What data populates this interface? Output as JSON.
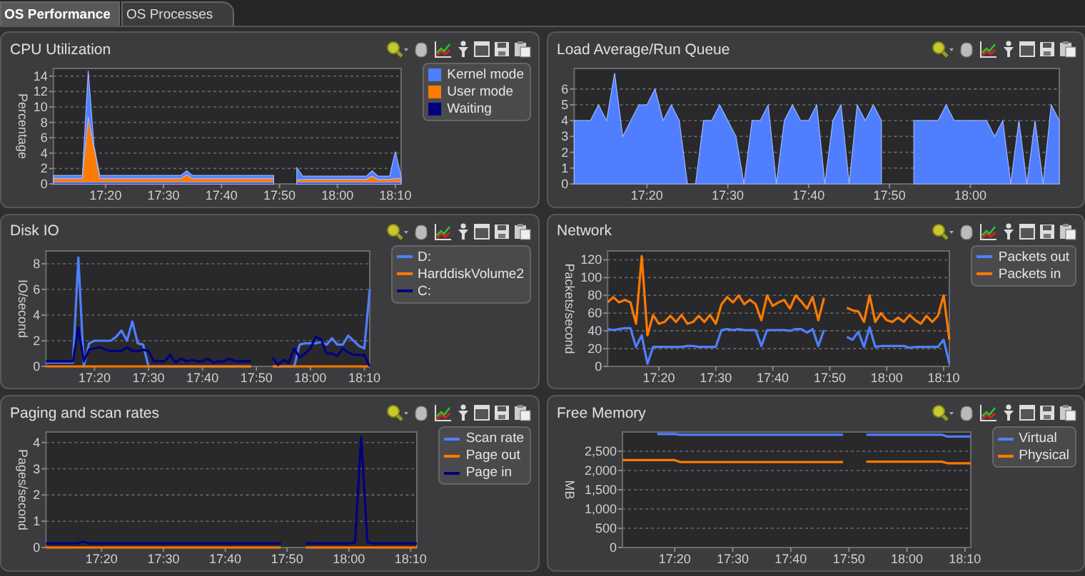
{
  "tabs": [
    {
      "label": "OS Performance",
      "selected": true
    },
    {
      "label": "OS Processes",
      "selected": false
    }
  ],
  "panels": [
    {
      "title": "CPU Utilization",
      "chart_data": {
        "type": "area",
        "ylabel": "Percentage",
        "categories": [
          null,
          null,
          null,
          null,
          null,
          null,
          null,
          null,
          null,
          "17:20",
          null,
          null,
          null,
          null,
          null,
          null,
          null,
          null,
          null,
          "17:30",
          null,
          null,
          null,
          null,
          null,
          null,
          null,
          null,
          null,
          "17:40",
          null,
          null,
          null,
          null,
          null,
          null,
          null,
          null,
          null,
          "17:50",
          null,
          null,
          null,
          null,
          null,
          null,
          null,
          null,
          null,
          "18:00",
          null,
          null,
          null,
          null,
          null,
          null,
          null,
          null,
          null,
          "18:10",
          null
        ],
        "ylim": [
          0,
          15
        ],
        "yticks": [
          0,
          2,
          4,
          6,
          8,
          10,
          12,
          14
        ],
        "series": [
          {
            "name": "Kernel mode",
            "color": "#4f7fff",
            "values": [
              1.1,
              1.1,
              1.1,
              1.1,
              1.1,
              1.1,
              14.7,
              5,
              1.1,
              1.1,
              1.1,
              1.1,
              1.1,
              1.1,
              1.1,
              1.1,
              1.1,
              1.1,
              1.1,
              1.1,
              1.1,
              1.1,
              1.1,
              1.7,
              1.1,
              1.1,
              1.1,
              1.1,
              1.1,
              1.1,
              1.1,
              1.1,
              1.1,
              1.1,
              1.1,
              1.1,
              1.1,
              1.1,
              1.1,
              null,
              null,
              null,
              2.1,
              1.0,
              1.0,
              1.0,
              1.0,
              1.0,
              1.0,
              1.0,
              1.0,
              1.0,
              1.0,
              1.0,
              1.0,
              1.7,
              1.0,
              1.0,
              1.0,
              4.2,
              1.0
            ]
          },
          {
            "name": "User mode",
            "color": "#ff7a00",
            "values": [
              0.7,
              0.7,
              0.7,
              0.7,
              0.7,
              0.7,
              8.7,
              4.7,
              0.7,
              0.7,
              0.7,
              0.7,
              0.7,
              0.7,
              0.7,
              0.7,
              0.7,
              0.7,
              0.7,
              0.7,
              0.7,
              0.7,
              0.7,
              1.2,
              0.7,
              0.7,
              0.7,
              0.7,
              0.7,
              0.7,
              0.7,
              0.7,
              0.7,
              0.7,
              0.7,
              0.7,
              0.7,
              0.7,
              0.7,
              null,
              null,
              null,
              0.5,
              0.6,
              0.6,
              0.6,
              0.6,
              0.6,
              0.6,
              0.6,
              0.6,
              0.6,
              0.6,
              0.6,
              0.6,
              1.0,
              0.6,
              0.6,
              0.6,
              0.7,
              0.7
            ]
          },
          {
            "name": "Waiting",
            "color": "#00007f",
            "values": [
              0.2,
              0.2,
              0.2,
              0.2,
              0.2,
              0.2,
              0.2,
              0.2,
              0.2,
              0.2,
              0.2,
              0.2,
              0.2,
              0.2,
              0.2,
              0.2,
              0.2,
              0.2,
              0.2,
              0.2,
              0.2,
              0.2,
              0.2,
              0.2,
              0.2,
              0.2,
              0.2,
              0.2,
              0.2,
              0.2,
              0.2,
              0.2,
              0.2,
              0.2,
              0.2,
              0.2,
              0.2,
              0.2,
              0.2,
              null,
              null,
              null,
              0.2,
              0.2,
              0.2,
              0.2,
              0.2,
              0.2,
              0.2,
              0.2,
              0.2,
              0.2,
              0.2,
              0.2,
              0.2,
              0.2,
              0.2,
              0.2,
              0.2,
              0.2,
              0.2
            ]
          }
        ],
        "grid": true
      }
    },
    {
      "title": "Load Average/Run Queue",
      "chart_data": {
        "type": "area",
        "categories": [
          null,
          null,
          null,
          null,
          null,
          null,
          null,
          null,
          null,
          "17:20",
          null,
          null,
          null,
          null,
          null,
          null,
          null,
          null,
          null,
          "17:30",
          null,
          null,
          null,
          null,
          null,
          null,
          null,
          null,
          null,
          "17:40",
          null,
          null,
          null,
          null,
          null,
          null,
          null,
          null,
          null,
          "17:50",
          null,
          null,
          null,
          null,
          null,
          null,
          null,
          null,
          null,
          "18:00",
          null,
          null,
          null,
          null,
          null,
          null,
          null,
          null,
          null,
          null,
          null
        ],
        "ylim": [
          0,
          7.3
        ],
        "yticks": [
          0,
          1,
          2,
          3,
          4,
          5,
          6
        ],
        "series": [
          {
            "color": "#4f7fff",
            "values": [
              4,
              4,
              4,
              5,
              4,
              7,
              3,
              4,
              5,
              5,
              6,
              4,
              5,
              4,
              0,
              0,
              4,
              4,
              5,
              4,
              3,
              0,
              4,
              4,
              5,
              0,
              4,
              5,
              4,
              4,
              5,
              0,
              4,
              5,
              0,
              5,
              4,
              5,
              4,
              null,
              null,
              null,
              4,
              4,
              4,
              4,
              5,
              4,
              4,
              4,
              4,
              4,
              3,
              4,
              0,
              4,
              0,
              4,
              0,
              5,
              4
            ]
          }
        ],
        "grid": true
      }
    },
    {
      "title": "Disk IO",
      "chart_data": {
        "type": "line",
        "ylabel": "IO/second",
        "categories": [
          null,
          null,
          null,
          null,
          null,
          null,
          null,
          null,
          null,
          "17:20",
          null,
          null,
          null,
          null,
          null,
          null,
          null,
          null,
          null,
          "17:30",
          null,
          null,
          null,
          null,
          null,
          null,
          null,
          null,
          null,
          "17:40",
          null,
          null,
          null,
          null,
          null,
          null,
          null,
          null,
          null,
          "17:50",
          null,
          null,
          null,
          null,
          null,
          null,
          null,
          null,
          null,
          "18:00",
          null,
          null,
          null,
          null,
          null,
          null,
          null,
          null,
          null,
          "18:10",
          null
        ],
        "ylim": [
          0,
          9
        ],
        "yticks": [
          0,
          2,
          4,
          6,
          8
        ],
        "series": [
          {
            "name": "D:",
            "color": "#4f7fff",
            "values": [
              0.3,
              0.3,
              0.3,
              0.3,
              0.3,
              0.3,
              8.5,
              0,
              1.8,
              2,
              2,
              2,
              2,
              2.3,
              2.8,
              2,
              3.5,
              1.8,
              1.7,
              0,
              0,
              0,
              0,
              0,
              0,
              0,
              0,
              0,
              0,
              0,
              0,
              0,
              0,
              0,
              0,
              0,
              0,
              0,
              0,
              null,
              null,
              null,
              0,
              0,
              0,
              0,
              0,
              1.7,
              1.8,
              1.8,
              1.8,
              1.9,
              1.7,
              2.2,
              1.7,
              1.7,
              2.4,
              2,
              1.6,
              1.4,
              6
            ]
          },
          {
            "name": "HarddiskVolume2",
            "color": "#ff7a00",
            "values": [
              0,
              0,
              0,
              0,
              0,
              0,
              0,
              0,
              0,
              0,
              0,
              0,
              0,
              0,
              0,
              0,
              0,
              0,
              0,
              0,
              0,
              0,
              0,
              0,
              0,
              0,
              0,
              0,
              0,
              0,
              0,
              0,
              0,
              0,
              0,
              0,
              0,
              0,
              0,
              null,
              null,
              null,
              0,
              0,
              0,
              0,
              0,
              0,
              0,
              0,
              0,
              0,
              0,
              0,
              0,
              0,
              0,
              0,
              0,
              0,
              0
            ]
          },
          {
            "name": "C:",
            "color": "#00007f",
            "values": [
              0.4,
              0.4,
              0.4,
              0.4,
              0.4,
              0.4,
              3,
              0.4,
              1.3,
              1.4,
              1.5,
              1.3,
              1.2,
              1.2,
              1.2,
              1.5,
              1.2,
              1.2,
              1.3,
              1.2,
              0.4,
              0.4,
              0.4,
              0.9,
              0.3,
              0.6,
              0.4,
              0.5,
              0.4,
              0.4,
              0.6,
              0.3,
              0.4,
              0.4,
              0.6,
              0.4,
              0.4,
              0.4,
              0.4,
              null,
              null,
              null,
              0.7,
              0.1,
              0.5,
              0.3,
              1.4,
              0.7,
              1,
              1.4,
              2.3,
              2.1,
              1,
              1,
              0.8,
              1.4,
              1.1,
              0.9,
              0.9,
              0.9,
              0
            ]
          }
        ],
        "grid": true
      }
    },
    {
      "title": "Network",
      "chart_data": {
        "type": "line",
        "ylabel": "Packets/second",
        "categories": [
          null,
          null,
          null,
          null,
          null,
          null,
          null,
          null,
          null,
          "17:20",
          null,
          null,
          null,
          null,
          null,
          null,
          null,
          null,
          null,
          "17:30",
          null,
          null,
          null,
          null,
          null,
          null,
          null,
          null,
          null,
          "17:40",
          null,
          null,
          null,
          null,
          null,
          null,
          null,
          null,
          null,
          "17:50",
          null,
          null,
          null,
          null,
          null,
          null,
          null,
          null,
          null,
          "18:00",
          null,
          null,
          null,
          null,
          null,
          null,
          null,
          null,
          null,
          "18:10",
          null
        ],
        "ylim": [
          0,
          130
        ],
        "yticks": [
          0,
          20,
          40,
          60,
          80,
          100,
          120
        ],
        "series": [
          {
            "name": "Packets out",
            "color": "#4f7fff",
            "values": [
              42,
              41,
              42,
              43,
              43,
              22,
              35,
              3,
              22,
              22,
              22,
              22,
              22,
              22,
              23,
              23,
              22,
              22,
              22,
              22,
              41,
              42,
              41,
              42,
              41,
              41,
              41,
              23,
              41,
              41,
              41,
              41,
              40,
              42,
              42,
              38,
              42,
              23,
              41,
              null,
              null,
              null,
              33,
              30,
              39,
              22,
              44,
              22,
              23,
              23,
              23,
              23,
              23,
              21,
              22,
              22,
              22,
              22,
              22,
              30,
              3
            ]
          },
          {
            "name": "Packets in",
            "color": "#ff7a00",
            "values": [
              72,
              78,
              72,
              75,
              72,
              48,
              124,
              35,
              58,
              48,
              50,
              57,
              50,
              58,
              48,
              50,
              57,
              50,
              58,
              48,
              70,
              78,
              72,
              80,
              70,
              75,
              70,
              52,
              80,
              68,
              72,
              75,
              65,
              80,
              73,
              65,
              78,
              52,
              77,
              null,
              null,
              null,
              66,
              63,
              62,
              50,
              80,
              50,
              60,
              52,
              50,
              55,
              50,
              58,
              52,
              48,
              57,
              50,
              57,
              80,
              30
            ]
          }
        ],
        "grid": true
      }
    },
    {
      "title": "Paging and scan rates",
      "chart_data": {
        "type": "line",
        "ylabel": "Pages/second",
        "categories": [
          null,
          null,
          null,
          null,
          null,
          null,
          null,
          null,
          null,
          "17:20",
          null,
          null,
          null,
          null,
          null,
          null,
          null,
          null,
          null,
          "17:30",
          null,
          null,
          null,
          null,
          null,
          null,
          null,
          null,
          null,
          "17:40",
          null,
          null,
          null,
          null,
          null,
          null,
          null,
          null,
          null,
          "17:50",
          null,
          null,
          null,
          null,
          null,
          null,
          null,
          null,
          null,
          "18:00",
          null,
          null,
          null,
          null,
          null,
          null,
          null,
          null,
          null,
          "18:10",
          null
        ],
        "ylim": [
          0,
          4.4
        ],
        "yticks": [
          0,
          1,
          2,
          3,
          4
        ],
        "series": [
          {
            "name": "Scan rate",
            "color": "#4f7fff",
            "values": [
              null,
              null,
              null,
              null,
              null,
              null,
              null,
              null,
              null,
              null,
              null,
              null,
              null,
              null,
              null,
              null,
              null,
              null,
              null,
              null,
              null,
              null,
              null,
              null,
              null,
              null,
              null,
              null,
              null,
              null,
              null,
              null,
              null,
              null,
              null,
              null,
              null,
              null,
              null,
              null,
              null,
              null,
              null,
              null,
              null,
              null,
              null,
              null,
              null,
              null,
              null,
              null,
              null,
              null,
              null,
              null,
              null,
              null,
              null,
              null,
              null
            ]
          },
          {
            "name": "Page out",
            "color": "#ff7a00",
            "values": [
              0,
              0,
              0,
              0,
              0,
              0,
              0,
              0,
              0,
              0,
              0,
              0,
              0,
              0,
              0,
              0,
              0,
              0,
              0,
              0,
              0,
              0,
              0,
              0,
              0,
              0,
              0,
              0,
              0,
              0,
              0,
              0,
              0,
              0,
              0,
              0,
              0,
              0,
              0,
              null,
              null,
              null,
              0,
              0,
              0,
              0,
              0,
              0,
              0,
              0,
              0,
              0,
              0,
              0,
              0,
              0,
              0,
              0,
              0,
              0,
              0
            ]
          },
          {
            "name": "Page in",
            "color": "#00007f",
            "values": [
              0.15,
              0.15,
              0.15,
              0.15,
              0.15,
              0.15,
              0.22,
              0.15,
              0.15,
              0.15,
              0.15,
              0.15,
              0.15,
              0.15,
              0.15,
              0.15,
              0.15,
              0.15,
              0.15,
              0.15,
              0.15,
              0.15,
              0.15,
              0.15,
              0.15,
              0.15,
              0.15,
              0.15,
              0.15,
              0.15,
              0.15,
              0.15,
              0.15,
              0.15,
              0.15,
              0.15,
              0.15,
              0.15,
              0.15,
              null,
              null,
              null,
              0.15,
              0.15,
              0.15,
              0.15,
              0.15,
              0.15,
              0.15,
              0.15,
              0.2,
              4.2,
              0.2,
              0.15,
              0.15,
              0.15,
              0.15,
              0.15,
              0.15,
              0.15,
              0.15
            ]
          }
        ],
        "grid": true
      }
    },
    {
      "title": "Free Memory",
      "chart_data": {
        "type": "line",
        "ylabel": "MB",
        "categories": [
          null,
          null,
          null,
          null,
          null,
          null,
          null,
          null,
          null,
          "17:20",
          null,
          null,
          null,
          null,
          null,
          null,
          null,
          null,
          null,
          "17:30",
          null,
          null,
          null,
          null,
          null,
          null,
          null,
          null,
          null,
          "17:40",
          null,
          null,
          null,
          null,
          null,
          null,
          null,
          null,
          null,
          "17:50",
          null,
          null,
          null,
          null,
          null,
          null,
          null,
          null,
          null,
          "18:00",
          null,
          null,
          null,
          null,
          null,
          null,
          null,
          null,
          null,
          "18:10",
          null
        ],
        "ylim": [
          0,
          3000
        ],
        "yticks": [
          {
            "value": 0,
            "label": "0"
          },
          {
            "value": 500,
            "label": "500"
          },
          {
            "value": 1000,
            "label": "1,000"
          },
          {
            "value": 1500,
            "label": "1,500"
          },
          {
            "value": 2000,
            "label": "2,000"
          },
          {
            "value": 2500,
            "label": "2,500"
          }
        ],
        "series": [
          {
            "name": "Virtual",
            "color": "#4f7fff",
            "values": [
              null,
              null,
              null,
              null,
              null,
              null,
              2950,
              2950,
              2950,
              2950,
              2930,
              2930,
              2930,
              2930,
              2930,
              2930,
              2930,
              2930,
              2930,
              2930,
              2930,
              2930,
              2930,
              2930,
              2930,
              2930,
              2930,
              2930,
              2930,
              2930,
              2930,
              2930,
              2930,
              2930,
              2930,
              2930,
              2930,
              2930,
              2930,
              null,
              null,
              null,
              2930,
              2930,
              2930,
              2930,
              2930,
              2930,
              2930,
              2930,
              2930,
              2930,
              2930,
              2930,
              2930,
              2930,
              2880,
              2880,
              2880,
              2880,
              2880
            ]
          },
          {
            "name": "Physical",
            "color": "#ff7a00",
            "values": [
              2270,
              2270,
              2270,
              2270,
              2270,
              2270,
              2270,
              2270,
              2270,
              2270,
              2220,
              2220,
              2220,
              2220,
              2220,
              2220,
              2220,
              2220,
              2220,
              2220,
              2220,
              2220,
              2220,
              2220,
              2220,
              2220,
              2220,
              2220,
              2220,
              2220,
              2220,
              2220,
              2220,
              2220,
              2220,
              2220,
              2220,
              2220,
              2220,
              null,
              null,
              null,
              2230,
              2230,
              2230,
              2230,
              2230,
              2230,
              2230,
              2230,
              2230,
              2230,
              2230,
              2230,
              2230,
              2230,
              2190,
              2190,
              2190,
              2190,
              2190
            ]
          }
        ],
        "grid": true
      }
    }
  ]
}
